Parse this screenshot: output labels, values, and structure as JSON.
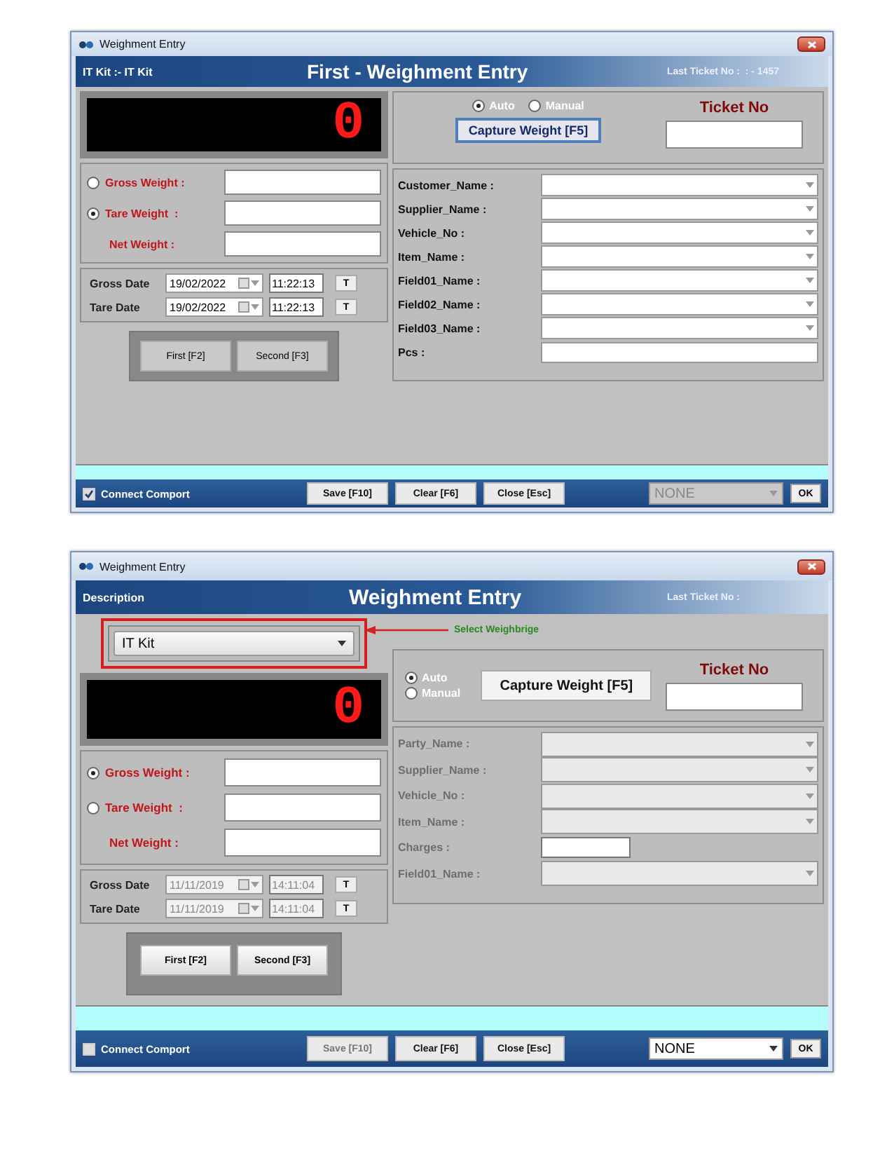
{
  "windows": [
    {
      "title": "Weighment Entry",
      "header": {
        "left": "IT Kit :- IT Kit",
        "title": "First - Weighment Entry",
        "right": "Last Ticket No :  : - 1457"
      },
      "display": "0",
      "modes": [
        {
          "label": "Auto",
          "selected": true
        },
        {
          "label": "Manual",
          "selected": false
        }
      ],
      "capture_button": "Capture Weight [F5]",
      "ticket_label": "Ticket No",
      "weights": [
        {
          "kind": "radio",
          "label": "Gross Weight :",
          "selected": false
        },
        {
          "kind": "radio",
          "label": "Tare Weight  :",
          "selected": true
        },
        {
          "kind": "plain",
          "label": "Net Weight :"
        }
      ],
      "dates_disabled": false,
      "dates": [
        {
          "label": "Gross Date",
          "date": "19/02/2022",
          "time": "11:22:13",
          "button": "T"
        },
        {
          "label": "Tare Date",
          "date": "19/02/2022",
          "time": "11:22:13",
          "button": "T"
        }
      ],
      "actions": [
        "First [F2]",
        "Second [F3]"
      ],
      "fields_disabled": false,
      "fields": [
        {
          "kind": "dropdown",
          "label": "Customer_Name :"
        },
        {
          "kind": "dropdown",
          "label": "Supplier_Name :"
        },
        {
          "kind": "dropdown",
          "label": "Vehicle_No :"
        },
        {
          "kind": "dropdown",
          "label": "Item_Name :"
        },
        {
          "kind": "dropdown",
          "label": "Field01_Name :"
        },
        {
          "kind": "dropdown",
          "label": "Field02_Name :"
        },
        {
          "kind": "dropdown",
          "label": "Field03_Name :"
        },
        {
          "kind": "text",
          "label": "Pcs :"
        }
      ],
      "connect": {
        "label": "Connect Comport",
        "checked": true
      },
      "buttons": [
        {
          "label": "Save [F10]",
          "disabled": false
        },
        {
          "label": "Clear [F6]",
          "disabled": false
        },
        {
          "label": "Close [Esc]",
          "disabled": false
        }
      ],
      "port": {
        "value": "NONE",
        "disabled": true
      },
      "ok": "OK"
    },
    {
      "title": "Weighment Entry",
      "header": {
        "left": "Description",
        "title": "Weighment Entry",
        "right": "Last Ticket No :"
      },
      "weighbridge": {
        "value": "IT Kit",
        "hint": "Select Weighbrige"
      },
      "display": "0",
      "modes": [
        {
          "label": "Auto",
          "selected": true
        },
        {
          "label": "Manual",
          "selected": false
        }
      ],
      "capture_button": "Capture Weight [F5]",
      "ticket_label": "Ticket No",
      "weights": [
        {
          "kind": "radio",
          "label": "Gross Weight :",
          "selected": true
        },
        {
          "kind": "radio",
          "label": "Tare Weight  :",
          "selected": false
        },
        {
          "kind": "plain",
          "label": "Net Weight :"
        }
      ],
      "dates_disabled": true,
      "dates": [
        {
          "label": "Gross Date",
          "date": "11/11/2019",
          "time": "14:11:04",
          "button": "T"
        },
        {
          "label": "Tare Date",
          "date": "11/11/2019",
          "time": "14:11:04",
          "button": "T"
        }
      ],
      "actions": [
        "First [F2]",
        "Second [F3]"
      ],
      "fields_disabled": true,
      "fields": [
        {
          "kind": "dropdown",
          "label": "Party_Name :"
        },
        {
          "kind": "dropdown",
          "label": "Supplier_Name :"
        },
        {
          "kind": "dropdown",
          "label": "Vehicle_No :"
        },
        {
          "kind": "dropdown",
          "label": "Item_Name :"
        },
        {
          "kind": "short",
          "label": "Charges :"
        },
        {
          "kind": "dropdown",
          "label": "Field01_Name :"
        }
      ],
      "connect": {
        "label": "Connect Comport",
        "checked": false
      },
      "buttons": [
        {
          "label": "Save [F10]",
          "disabled": true
        },
        {
          "label": "Clear [F6]",
          "disabled": false
        },
        {
          "label": "Close [Esc]",
          "disabled": false
        }
      ],
      "port": {
        "value": "NONE",
        "disabled": false
      },
      "ok": "OK"
    }
  ]
}
